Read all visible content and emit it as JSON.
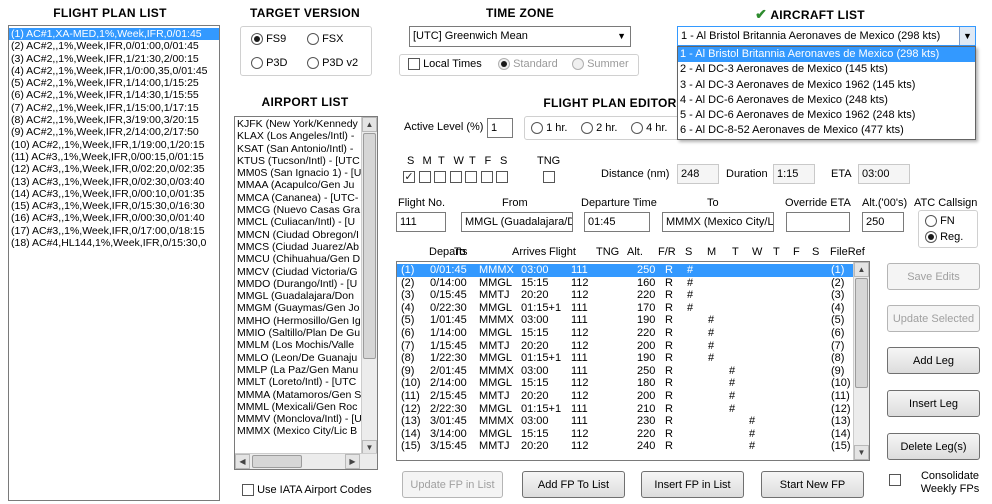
{
  "headers": {
    "flight_plan_list": "FLIGHT PLAN LIST",
    "target_version": "TARGET VERSION",
    "time_zone": "TIME ZONE",
    "aircraft_list": "AIRCRAFT LIST",
    "airport_list": "AIRPORT LIST",
    "flight_plan_editor": "FLIGHT PLAN EDITOR"
  },
  "flight_plans": [
    "(1) AC#1,XA-MED,1%,Week,IFR,0/01:45",
    "(2) AC#2,,1%,Week,IFR,0/01:00,0/01:45",
    "(3) AC#2,,1%,Week,IFR,1/21:30,2/00:15",
    "(4) AC#2,,1%,Week,IFR,1/0:00,35,0/01:45",
    "(5) AC#2,,1%,Week,IFR,1/14:00,1/15:25",
    "(6) AC#2,,1%,Week,IFR,1/14:30,1/15:55",
    "(7) AC#2,,1%,Week,IFR,1/15:00,1/17:15",
    "(8) AC#2,,1%,Week,IFR,3/19:00,3/20:15",
    "(9) AC#2,,1%,Week,IFR,2/14:00,2/17:50",
    "(10) AC#2,,1%,Week,IFR,1/19:00,1/20:15",
    "(11) AC#3,,1%,Week,IFR,0/00:15,0/01:15",
    "(12) AC#3,,1%,Week,IFR,0/02:20,0/02:35",
    "(13) AC#3,,1%,Week,IFR,0/02:30,0/03:40",
    "(14) AC#3,,1%,Week,IFR,0/00:10,0/01:35",
    "(15) AC#3,,1%,Week,IFR,0/15:30,0/16:30",
    "(16) AC#3,,1%,Week,IFR,0/00:30,0/01:40",
    "(17) AC#3,,1%,Week,IFR,0/17:00,0/18:15",
    "(18) AC#4,HL144,1%,Week,IFR,0/15:30,0"
  ],
  "target_version": {
    "fs9": "FS9",
    "fsx": "FSX",
    "p3d": "P3D",
    "p3dv2": "P3D v2"
  },
  "timezone": {
    "value": "[UTC] Greenwich Mean",
    "local_times": "Local Times",
    "standard": "Standard",
    "summer": "Summer"
  },
  "aircraft": {
    "selected": "1 - Al Bristol Britannia Aeronaves de Mexico (298 kts)",
    "options": [
      "1 - Al Bristol Britannia Aeronaves de Mexico (298 kts)",
      "2 - Al DC-3 Aeronaves de Mexico (145 kts)",
      "3 - Al DC-3 Aeronaves de Mexico 1962 (145 kts)",
      "4 - Al DC-6 Aeronaves de Mexico (248 kts)",
      "5 - Al DC-6 Aeronaves de Mexico 1962 (248 kts)",
      "6 - Al DC-8-52 Aeronaves de Mexico (477 kts)"
    ]
  },
  "airports": [
    "KJFK (New York/Kennedy",
    "KLAX (Los Angeles/Intl) -",
    "KSAT (San Antonio/Intl) -",
    "KTUS (Tucson/Intl) - [UTC",
    "MM0S (San Ignacio 1) - [U",
    "MMAA (Acapulco/Gen Ju",
    "MMCA (Cananea) - [UTC-",
    "MMCG (Nuevo Casas Gra",
    "MMCL (Culiacan/Intl) - [U",
    "MMCN (Ciudad Obregon/I",
    "MMCS (Ciudad Juarez/Ab",
    "MMCU (Chihuahua/Gen D",
    "MMCV (Ciudad Victoria/G",
    "MMDO (Durango/Intl) - [U",
    "MMGL (Guadalajara/Don",
    "MMGM (Guaymas/Gen Jo",
    "MMHO (Hermosillo/Gen Ig",
    "MMIO (Saltillo/Plan De Gu",
    "MMLM (Los Mochis/Valle",
    "MMLO (Leon/De Guanaju",
    "MMLP (La Paz/Gen Manu",
    "MMLT (Loreto/Intl) - [UTC",
    "MMMA (Matamoros/Gen S",
    "MMML (Mexicali/Gen Roc",
    "MMMV (Monclova/Intl) - [U",
    "MMMX (Mexico City/Lic B"
  ],
  "use_iata": "Use IATA Airport Codes",
  "editor": {
    "active_level_label": "Active Level (%)",
    "active_level_value": "1",
    "hr1": "1 hr.",
    "hr2": "2 hr.",
    "hr4": "4 hr.",
    "days": [
      "S",
      "M",
      "T",
      "W",
      "T",
      "F",
      "S"
    ],
    "tng_label": "TNG",
    "distance_label": "Distance (nm)",
    "distance_value": "248",
    "duration_label": "Duration",
    "duration_value": "1:15",
    "eta_label": "ETA",
    "eta_value": "03:00",
    "flight_no_label": "Flight No.",
    "flight_no_value": "111",
    "from_label": "From",
    "from_value": "MMGL (Guadalajara/D",
    "dep_label": "Departure Time",
    "dep_value": "01:45",
    "to_label": "To",
    "to_value": "MMMX (Mexico City/L",
    "override_label": "Override ETA",
    "override_value": "",
    "alt_label": "Alt.('00's)",
    "alt_value": "250",
    "atc_label": "ATC Callsign",
    "fn": "FN",
    "reg": "Reg."
  },
  "legs_headers": [
    "Departs",
    "To",
    "Arrives",
    "Flight",
    "TNG",
    "Alt.",
    "F/R",
    "S",
    "M",
    "T",
    "W",
    "T",
    "F",
    "S",
    "FileRef"
  ],
  "legs": [
    {
      "n": "(1)",
      "dep": "0/01:45",
      "to": "MMMX",
      "arr": "03:00",
      "fl": "111",
      "alt": "250",
      "fr": "R",
      "d": 0,
      "ref": "(1)"
    },
    {
      "n": "(2)",
      "dep": "0/14:00",
      "to": "MMGL",
      "arr": "15:15",
      "fl": "112",
      "alt": "160",
      "fr": "R",
      "d": 0,
      "ref": "(2)"
    },
    {
      "n": "(3)",
      "dep": "0/15:45",
      "to": "MMTJ",
      "arr": "20:20",
      "fl": "112",
      "alt": "220",
      "fr": "R",
      "d": 0,
      "ref": "(3)"
    },
    {
      "n": "(4)",
      "dep": "0/22:30",
      "to": "MMGL",
      "arr": "01:15+1",
      "fl": "111",
      "alt": "170",
      "fr": "R",
      "d": 0,
      "ref": "(4)"
    },
    {
      "n": "(5)",
      "dep": "1/01:45",
      "to": "MMMX",
      "arr": "03:00",
      "fl": "111",
      "alt": "190",
      "fr": "R",
      "d": 1,
      "ref": "(5)"
    },
    {
      "n": "(6)",
      "dep": "1/14:00",
      "to": "MMGL",
      "arr": "15:15",
      "fl": "112",
      "alt": "220",
      "fr": "R",
      "d": 1,
      "ref": "(6)"
    },
    {
      "n": "(7)",
      "dep": "1/15:45",
      "to": "MMTJ",
      "arr": "20:20",
      "fl": "112",
      "alt": "200",
      "fr": "R",
      "d": 1,
      "ref": "(7)"
    },
    {
      "n": "(8)",
      "dep": "1/22:30",
      "to": "MMGL",
      "arr": "01:15+1",
      "fl": "111",
      "alt": "190",
      "fr": "R",
      "d": 1,
      "ref": "(8)"
    },
    {
      "n": "(9)",
      "dep": "2/01:45",
      "to": "MMMX",
      "arr": "03:00",
      "fl": "111",
      "alt": "250",
      "fr": "R",
      "d": 2,
      "ref": "(9)"
    },
    {
      "n": "(10)",
      "dep": "2/14:00",
      "to": "MMGL",
      "arr": "15:15",
      "fl": "112",
      "alt": "180",
      "fr": "R",
      "d": 2,
      "ref": "(10)"
    },
    {
      "n": "(11)",
      "dep": "2/15:45",
      "to": "MMTJ",
      "arr": "20:20",
      "fl": "112",
      "alt": "200",
      "fr": "R",
      "d": 2,
      "ref": "(11)"
    },
    {
      "n": "(12)",
      "dep": "2/22:30",
      "to": "MMGL",
      "arr": "01:15+1",
      "fl": "111",
      "alt": "210",
      "fr": "R",
      "d": 2,
      "ref": "(12)"
    },
    {
      "n": "(13)",
      "dep": "3/01:45",
      "to": "MMMX",
      "arr": "03:00",
      "fl": "111",
      "alt": "230",
      "fr": "R",
      "d": 3,
      "ref": "(13)"
    },
    {
      "n": "(14)",
      "dep": "3/14:00",
      "to": "MMGL",
      "arr": "15:15",
      "fl": "112",
      "alt": "220",
      "fr": "R",
      "d": 3,
      "ref": "(14)"
    },
    {
      "n": "(15)",
      "dep": "3/15:45",
      "to": "MMTJ",
      "arr": "20:20",
      "fl": "112",
      "alt": "240",
      "fr": "R",
      "d": 3,
      "ref": "(15)"
    }
  ],
  "mark": "#",
  "buttons": {
    "save_edits": "Save Edits",
    "update_selected": "Update Selected",
    "add_leg": "Add Leg",
    "insert_leg": "Insert Leg",
    "delete_legs": "Delete Leg(s)",
    "update_fp": "Update FP in List",
    "add_fp": "Add FP To List",
    "insert_fp": "Insert FP in List",
    "start_new": "Start New FP",
    "consolidate": "Consolidate Weekly FPs"
  },
  "colors": {
    "selection": "#3399ff",
    "check_green": "#2e8b2e"
  }
}
